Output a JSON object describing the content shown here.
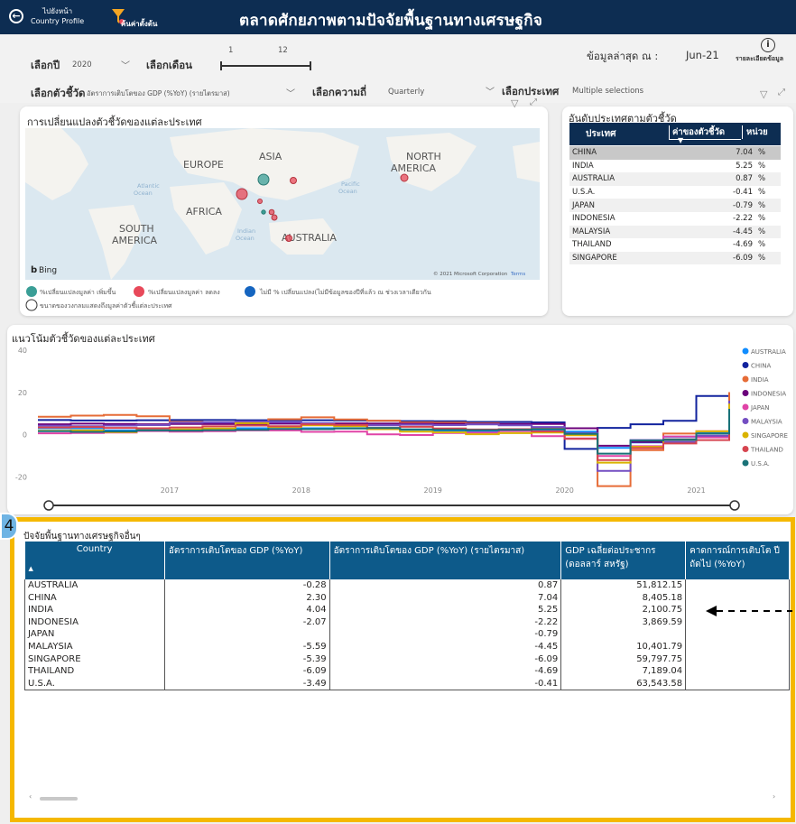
{
  "header": {
    "back_label_line1": "ไปยังหน้า",
    "back_label_line2": "Country Profile",
    "home_label": "ค้นค่าตั้งต้น",
    "title": "ตลาดศักยภาพตามปัจจัยพื้นฐานทางเศรษฐกิจ"
  },
  "filters": {
    "year_label": "เลือกปี",
    "year_value": "2020",
    "month_label": "เลือกเดือน",
    "month_min": "1",
    "month_max": "12",
    "latest_label": "ข้อมูลล่าสุด ณ :",
    "latest_value": "Jun-21",
    "info_label": "รายละเอียดข้อมูล",
    "indicator_label": "เลือกตัวชี้วัด",
    "indicator_value": "อัตราการเติบโตของ GDP (%YoY) (รายไตรมาส)",
    "freq_label": "เลือกความถี่",
    "freq_value": "Quarterly",
    "country_label": "เลือกประเทศ",
    "country_value": "Multiple selections"
  },
  "map_panel": {
    "title": "การเปลี่ยนแปลงตัวชี้วัดของแต่ละประเทศ",
    "labels": {
      "europe": "EUROPE",
      "asia": "ASIA",
      "north_america_1": "NORTH",
      "north_america_2": "AMERICA",
      "africa": "AFRICA",
      "south_america_1": "SOUTH",
      "south_america_2": "AMERICA",
      "australia": "AUSTRALIA",
      "atlantic_1": "Atlantic",
      "atlantic_2": "Ocean",
      "pacific_1": "Pacific",
      "pacific_2": "Ocean",
      "indian_1": "Indian",
      "indian_2": "Ocean"
    },
    "bing": "Bing",
    "copyright": "© 2021 Microsoft Corporation",
    "terms": "Terms",
    "legend": {
      "up": "%เปลี่ยนแปลงมูลค่า เพิ่มขึ้น",
      "down": "%เปลี่ยนแปลงมูลค่า ลดลง",
      "none": "ไม่มี % เปลี่ยนแปลง(ไม่มีข้อมูลของปีที่แล้ว ณ ช่วงเวลาเดียวกัน",
      "size": "ขนาดของวงกลมแสดงถึงมูลค่าตัวชี้แต่ละประเทศ"
    },
    "colors": {
      "up": "#3a9e96",
      "down": "#e8495a",
      "none": "#1565c0"
    }
  },
  "rank_panel": {
    "title": "อันดับประเทศตามตัวชี้วัด",
    "col_country": "ประเทศ",
    "col_value": "ค่าของตัวชี้วัด",
    "col_unit": "หน่วย",
    "rows": [
      {
        "country": "CHINA",
        "value": "7.04",
        "unit": "%"
      },
      {
        "country": "INDIA",
        "value": "5.25",
        "unit": "%"
      },
      {
        "country": "AUSTRALIA",
        "value": "0.87",
        "unit": "%"
      },
      {
        "country": "U.S.A.",
        "value": "-0.41",
        "unit": "%"
      },
      {
        "country": "JAPAN",
        "value": "-0.79",
        "unit": "%"
      },
      {
        "country": "INDONESIA",
        "value": "-2.22",
        "unit": "%"
      },
      {
        "country": "MALAYSIA",
        "value": "-4.45",
        "unit": "%"
      },
      {
        "country": "THAILAND",
        "value": "-4.69",
        "unit": "%"
      },
      {
        "country": "SINGAPORE",
        "value": "-6.09",
        "unit": "%"
      }
    ]
  },
  "trend_panel": {
    "title": "แนวโน้มตัวชี้วัดของแต่ละประเทศ"
  },
  "chart_data": {
    "type": "line",
    "title": "แนวโน้มตัวชี้วัดของแต่ละประเทศ",
    "x": [
      "2016Q1",
      "2016Q2",
      "2016Q3",
      "2016Q4",
      "2017Q1",
      "2017Q2",
      "2017Q3",
      "2017Q4",
      "2018Q1",
      "2018Q2",
      "2018Q3",
      "2018Q4",
      "2019Q1",
      "2019Q2",
      "2019Q3",
      "2019Q4",
      "2020Q1",
      "2020Q2",
      "2020Q3",
      "2020Q4",
      "2021Q1",
      "2021Q2"
    ],
    "x_ticks": [
      "2017",
      "2018",
      "2019",
      "2020",
      "2021"
    ],
    "y_ticks": [
      "40",
      "20",
      "0",
      "-20"
    ],
    "ylim": [
      -25,
      40
    ],
    "legend_position": "right",
    "series": [
      {
        "name": "AUSTRALIA",
        "color": "#118dff",
        "values": [
          3,
          3,
          2,
          2.5,
          2,
          2,
          3,
          2.5,
          3,
          3,
          2.8,
          2.3,
          1.7,
          1.6,
          1.8,
          2.2,
          1.4,
          -6.3,
          -3.7,
          -1,
          1.1,
          9.6
        ]
      },
      {
        "name": "CHINA",
        "color": "#12239e",
        "values": [
          6.9,
          6.7,
          6.7,
          6.8,
          6.9,
          6.9,
          6.8,
          6.8,
          6.8,
          6.7,
          6.5,
          6.4,
          6.3,
          6,
          6,
          5.8,
          -6.8,
          3.2,
          4.9,
          6.5,
          18.3,
          7.9
        ]
      },
      {
        "name": "INDIA",
        "color": "#e66c37",
        "values": [
          8.5,
          9,
          9.3,
          8.7,
          6,
          5,
          6.2,
          7.3,
          8.2,
          7.2,
          6.6,
          5.8,
          5.7,
          5.4,
          4.6,
          3.3,
          3,
          -24.4,
          -7.4,
          0.5,
          1.6,
          20.1
        ]
      },
      {
        "name": "INDONESIA",
        "color": "#6b007b",
        "values": [
          4.9,
          5.2,
          5,
          4.9,
          5,
          5,
          5.1,
          5.2,
          5.1,
          5.3,
          5.2,
          5.2,
          5.1,
          5.1,
          5,
          5,
          3,
          -5.3,
          -3.5,
          -2.2,
          -0.7,
          7.1
        ]
      },
      {
        "name": "JAPAN",
        "color": "#e044a7",
        "values": [
          0.6,
          0.8,
          1,
          1.7,
          1.4,
          1.6,
          2,
          2,
          1.3,
          1.4,
          0.1,
          -0.2,
          0.8,
          0.9,
          1.7,
          -0.7,
          -1.8,
          -10.1,
          -5.5,
          -0.9,
          -1.3,
          7.6
        ]
      },
      {
        "name": "MALAYSIA",
        "color": "#744ec2",
        "values": [
          4.2,
          4,
          4.3,
          4.5,
          5.6,
          5.8,
          6.2,
          5.9,
          5.4,
          4.5,
          4.4,
          4.7,
          4.5,
          4.8,
          4.4,
          3.6,
          0.7,
          -17.2,
          -2.6,
          -3.4,
          -0.5,
          16.1
        ]
      },
      {
        "name": "SINGAPORE",
        "color": "#d9b300",
        "values": [
          1.8,
          2,
          1.2,
          2.9,
          2.5,
          2.9,
          5.4,
          3.6,
          4.4,
          4,
          2.6,
          1.4,
          1.1,
          0.2,
          0.7,
          1,
          -0.3,
          -13.3,
          -5.8,
          -2.4,
          1.5,
          14.7
        ]
      },
      {
        "name": "THAILAND",
        "color": "#d64550",
        "values": [
          3.4,
          3.6,
          3.2,
          3,
          3.4,
          3.9,
          4.3,
          4,
          4.9,
          4.6,
          3.2,
          3.7,
          2.9,
          2.4,
          2.6,
          1.5,
          -2,
          -12.1,
          -6.4,
          -4.2,
          -2.6,
          7.5
        ]
      },
      {
        "name": "U.S.A.",
        "color": "#197278",
        "values": [
          1.6,
          1.3,
          1.5,
          2,
          1.9,
          2.1,
          2.3,
          2.7,
          2.6,
          2.9,
          3.1,
          2.5,
          2.3,
          2.1,
          2.3,
          2.6,
          0.3,
          -9,
          -2.8,
          -2.4,
          0.5,
          12.2
        ]
      }
    ]
  },
  "bottom_panel": {
    "badge": "4",
    "title": "ปัจจัยพื้นฐานทางเศรษฐกิจอื่นๆ",
    "columns": [
      "Country",
      "อัตราการเติบโตของ GDP (%YoY)",
      "อัตราการเติบโตของ GDP (%YoY) (รายไตรมาส)",
      "GDP เฉลี่ยต่อประชากร (ดอลลาร์ สหรัฐ)",
      "คาดการณ์การเติบโต ปีถัดไป (%YoY)"
    ],
    "rows": [
      {
        "country": "AUSTRALIA",
        "gdp": "-0.28",
        "gdp_q": "0.87",
        "gdp_pc": "51,812.15",
        "forecast": ""
      },
      {
        "country": "CHINA",
        "gdp": "2.30",
        "gdp_q": "7.04",
        "gdp_pc": "8,405.18",
        "forecast": ""
      },
      {
        "country": "INDIA",
        "gdp": "4.04",
        "gdp_q": "5.25",
        "gdp_pc": "2,100.75",
        "forecast": ""
      },
      {
        "country": "INDONESIA",
        "gdp": "-2.07",
        "gdp_q": "-2.22",
        "gdp_pc": "3,869.59",
        "forecast": ""
      },
      {
        "country": "JAPAN",
        "gdp": "",
        "gdp_q": "-0.79",
        "gdp_pc": "",
        "forecast": ""
      },
      {
        "country": "MALAYSIA",
        "gdp": "-5.59",
        "gdp_q": "-4.45",
        "gdp_pc": "10,401.79",
        "forecast": ""
      },
      {
        "country": "SINGAPORE",
        "gdp": "-5.39",
        "gdp_q": "-6.09",
        "gdp_pc": "59,797.75",
        "forecast": ""
      },
      {
        "country": "THAILAND",
        "gdp": "-6.09",
        "gdp_q": "-4.69",
        "gdp_pc": "7,189.04",
        "forecast": ""
      },
      {
        "country": "U.S.A.",
        "gdp": "-3.49",
        "gdp_q": "-0.41",
        "gdp_pc": "63,543.58",
        "forecast": ""
      }
    ],
    "highlight_color": "#f5b800"
  }
}
